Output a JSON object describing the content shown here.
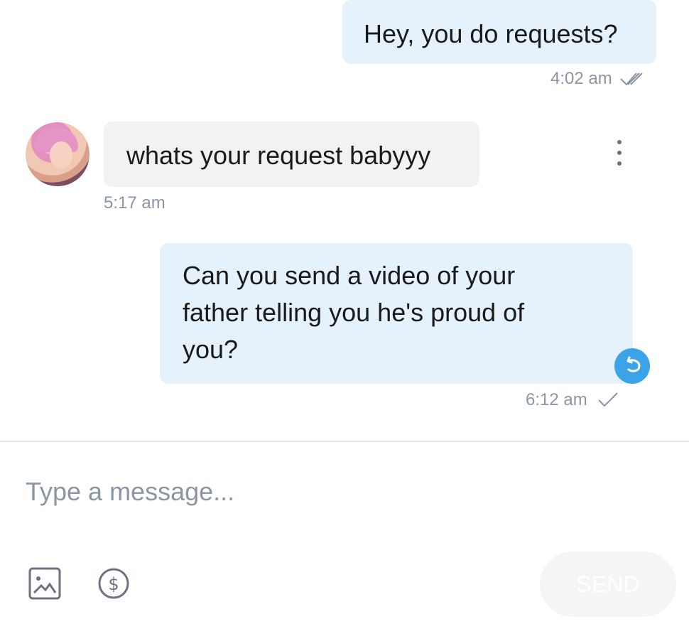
{
  "messages": [
    {
      "direction": "outgoing",
      "text": "Hey, you do requests?",
      "time": "4:02 am",
      "status": "read"
    },
    {
      "direction": "incoming",
      "text": "whats your request babyyy",
      "time": "5:17 am",
      "sender_avatar": "avatar"
    },
    {
      "direction": "outgoing",
      "text": "Can you send a video of your father telling you he's proud of you?",
      "time": "6:12 am",
      "status": "sent",
      "action_icon": "undo-icon"
    }
  ],
  "composer": {
    "placeholder": "Type a message...",
    "value": "",
    "send_label": "SEND"
  },
  "icons": {
    "image": "image-icon",
    "tip": "dollar-icon",
    "more": "more-options-icon",
    "read": "double-check-icon",
    "sent": "check-icon"
  },
  "colors": {
    "outgoing_bubble": "#e5f1fb",
    "incoming_bubble": "#f1f2f4",
    "accent": "#3ba3e8",
    "muted_text": "#8a96a3"
  }
}
